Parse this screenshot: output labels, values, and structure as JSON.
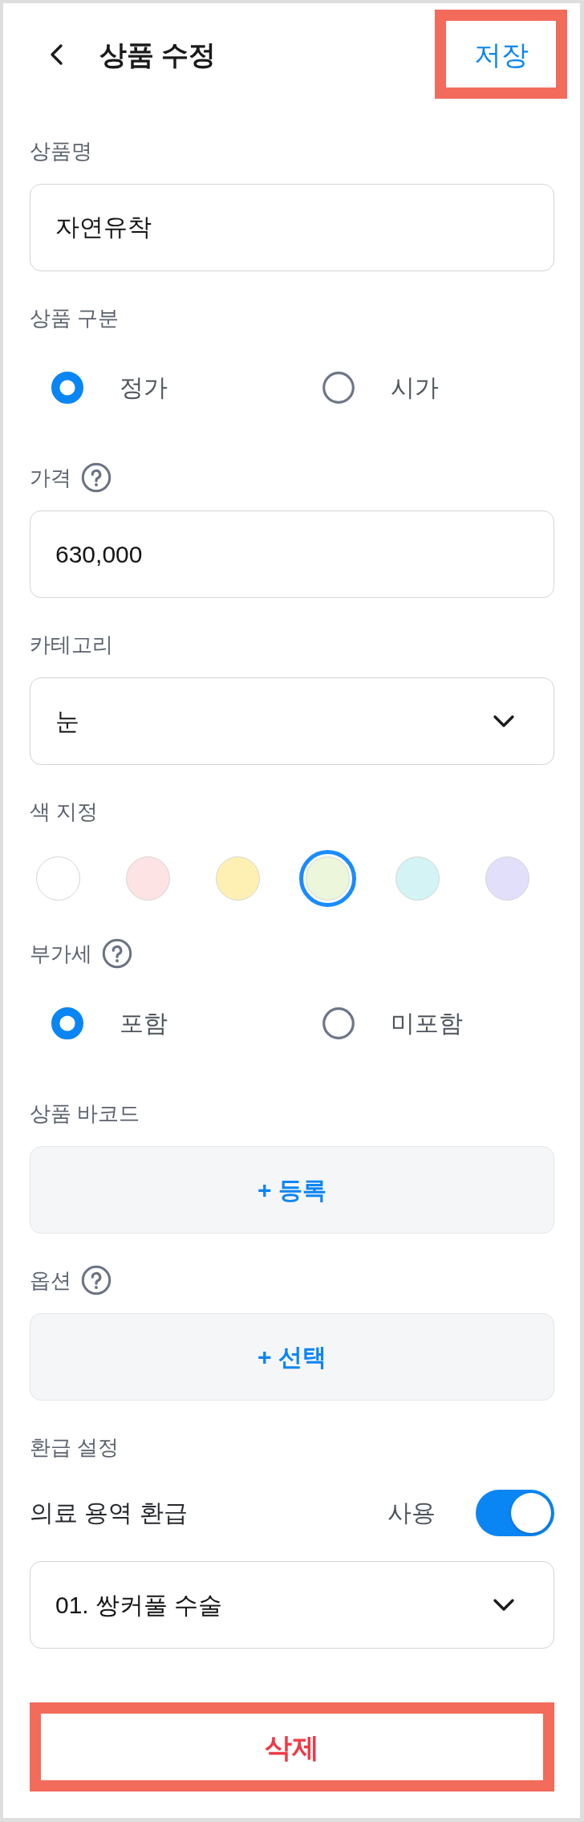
{
  "header": {
    "title": "상품 수정",
    "save_button": {
      "label": "저장",
      "highlighted": true
    }
  },
  "sections": [
    {
      "kind": "text_input",
      "label": "상품명",
      "help": false,
      "value": "자연유착"
    },
    {
      "kind": "radio",
      "label": "상품 구분",
      "help": false,
      "options": [
        {
          "label": "정가",
          "selected": true
        },
        {
          "label": "시가",
          "selected": false
        }
      ]
    },
    {
      "kind": "text_input",
      "label": "가격",
      "help": true,
      "value": "630,000"
    },
    {
      "kind": "select",
      "label": "카테고리",
      "help": false,
      "value": "눈"
    },
    {
      "kind": "colors",
      "label": "색 지정",
      "help": false,
      "swatches": [
        {
          "color": "#ffffff",
          "selected": false
        },
        {
          "color": "#fde3e3",
          "selected": false
        },
        {
          "color": "#fef0b2",
          "selected": false
        },
        {
          "color": "#ebf6da",
          "selected": true
        },
        {
          "color": "#d3f3f4",
          "selected": false
        },
        {
          "color": "#e1dffa",
          "selected": false
        }
      ]
    },
    {
      "kind": "radio",
      "label": "부가세",
      "help": true,
      "options": [
        {
          "label": "포함",
          "selected": true
        },
        {
          "label": "미포함",
          "selected": false
        }
      ]
    },
    {
      "kind": "add_button",
      "label": "상품 바코드",
      "help": false,
      "button": "+ 등록"
    },
    {
      "kind": "add_button",
      "label": "옵션",
      "help": true,
      "button": "+ 선택"
    },
    {
      "kind": "refund",
      "label": "환급 설정",
      "help": false,
      "item": "의료 용역 환급",
      "toggle_label": "사용",
      "on": true,
      "value": "01. 쌍커풀 수술"
    }
  ],
  "delete_button": {
    "label": "삭제",
    "highlighted": true
  }
}
